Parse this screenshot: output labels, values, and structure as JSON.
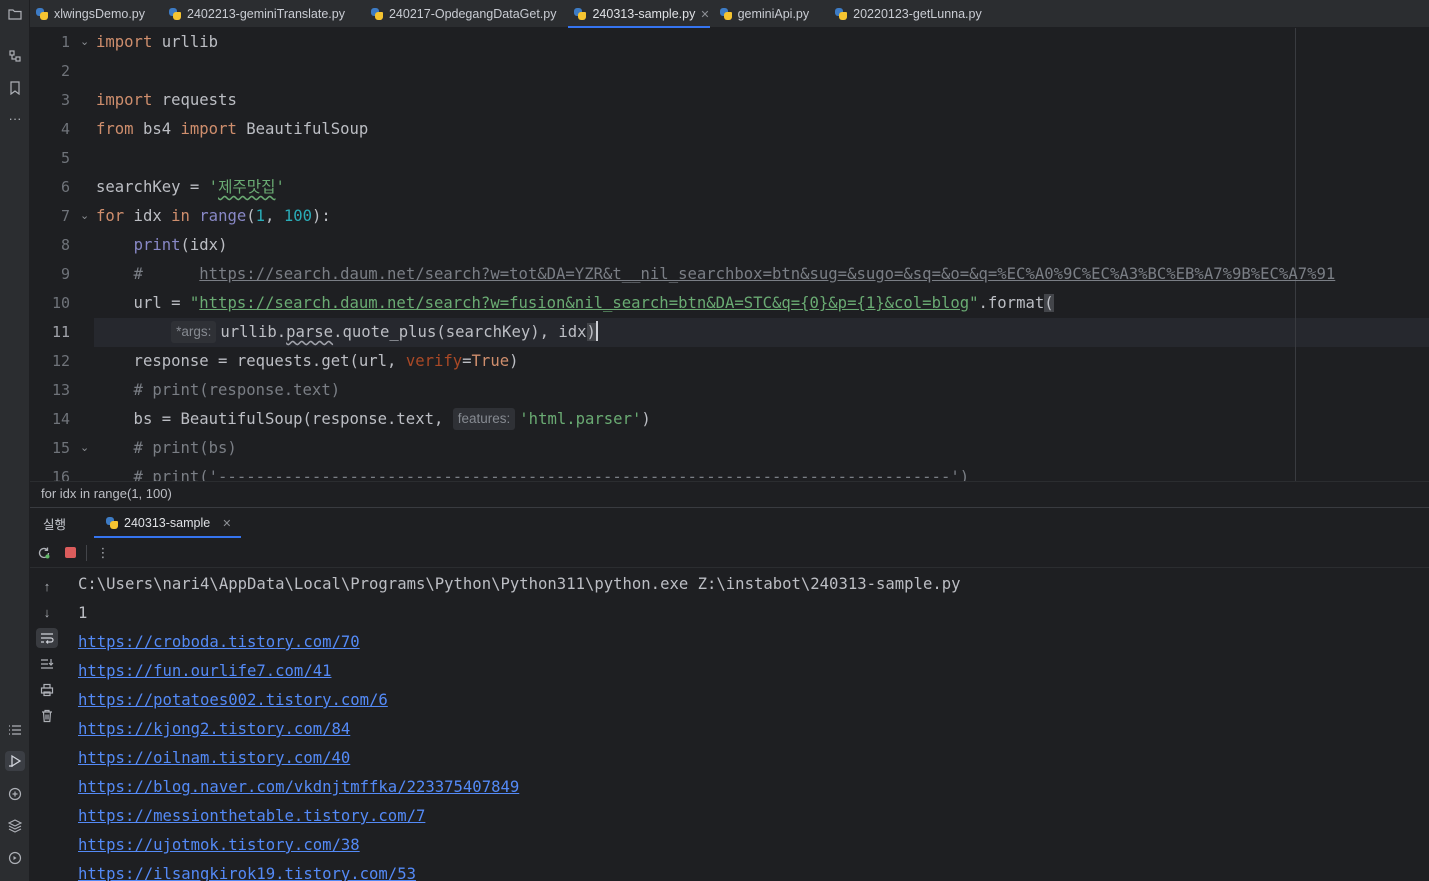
{
  "tabs": [
    {
      "label": "xlwingsDemo.py",
      "active": false
    },
    {
      "label": "2402213-geminiTranslate.py",
      "active": false
    },
    {
      "label": "240217-OpdegangDataGet.py",
      "active": false
    },
    {
      "label": "240313-sample.py",
      "active": true
    },
    {
      "label": "geminiApi.py",
      "active": false
    },
    {
      "label": "20220123-getLunna.py",
      "active": false
    }
  ],
  "editor": {
    "line_numbers": [
      "1",
      "2",
      "3",
      "4",
      "5",
      "6",
      "7",
      "8",
      "9",
      "10",
      "11",
      "12",
      "13",
      "14",
      "15",
      "16"
    ],
    "current_line": "11",
    "code": {
      "l1_import": "import",
      "l1_mod": " urllib",
      "l3_import": "import",
      "l3_mod": " requests",
      "l4_from": "from",
      "l4_mod": " bs4 ",
      "l4_import": "import",
      "l4_cls": " BeautifulSoup",
      "l6_var": "searchKey = ",
      "l6_q1": "'",
      "l6_str": "제주맛집",
      "l6_q2": "'",
      "l7_for": "for",
      "l7_mid": " idx ",
      "l7_in": "in",
      "l7_range": " range",
      "l7_open": "(",
      "l7_n1": "1",
      "l7_comma": ", ",
      "l7_n2": "100",
      "l7_close": "):",
      "l8_indent": "    ",
      "l8_print": "print",
      "l8_arg": "(idx)",
      "l9_hash": "    #      ",
      "l9_url": "https://search.daum.net/search?w=tot&DA=YZR&t__nil_searchbox=btn&sug=&sugo=&sq=&o=&q=%EC%A0%9C%EC%A3%BC%EB%A7%9B%EC%A7%91",
      "l10_pre": "    url = ",
      "l10_q1": "\"",
      "l10_url": "https://search.daum.net/search?w=fusion&nil_search=btn&DA=STC&q={0}&p={1}&col=blog",
      "l10_q2": "\"",
      "l10_format": ".format",
      "l10_paren": "(",
      "l11_indent": "        ",
      "l11_hint": "*args:",
      "l11_mod": "urllib.",
      "l11_parse": "parse",
      "l11_rest": ".quote_plus(searchKey), idx",
      "l11_paren": ")",
      "l12_pre": "    response = requests.get(url, ",
      "l12_kw": "verify",
      "l12_eq": "=",
      "l12_true": "True",
      "l12_close": ")",
      "l13": "    # print(response.text)",
      "l14_pre": "    bs = BeautifulSoup(response.text, ",
      "l14_hint": "features:",
      "l14_str": "'html.parser'",
      "l14_close": ")",
      "l15": "    # print(bs)",
      "l16": "    # print('------------------------------------------------------------------------------')"
    }
  },
  "breadcrumb": "for idx in range(1, 100)",
  "run_panel": {
    "title": "실행",
    "tab_label": "240313-sample",
    "console_lines": [
      {
        "text": "C:\\Users\\nari4\\AppData\\Local\\Programs\\Python\\Python311\\python.exe Z:\\instabot\\240313-sample.py",
        "link": false
      },
      {
        "text": "1",
        "link": false
      },
      {
        "text": "https://croboda.tistory.com/70",
        "link": true
      },
      {
        "text": "https://fun.ourlife7.com/41",
        "link": true
      },
      {
        "text": "https://potatoes002.tistory.com/6",
        "link": true
      },
      {
        "text": "https://kjong2.tistory.com/84",
        "link": true
      },
      {
        "text": "https://oilnam.tistory.com/40",
        "link": true
      },
      {
        "text": "https://blog.naver.com/vkdnjtmffka/223375407849",
        "link": true
      },
      {
        "text": "https://messionthetable.tistory.com/7",
        "link": true
      },
      {
        "text": "https://ujotmok.tistory.com/38",
        "link": true
      },
      {
        "text": "https://ilsangkirok19.tistory.com/53",
        "link": true
      }
    ]
  },
  "icons": {
    "close": "✕",
    "more": "⋮",
    "up": "↑",
    "down": "↓",
    "ellipsis": "···"
  },
  "colors": {
    "accent": "#3574f0",
    "keyword": "#cf8e6d",
    "string": "#6aab73",
    "number": "#2aacb8",
    "link": "#548af7"
  }
}
